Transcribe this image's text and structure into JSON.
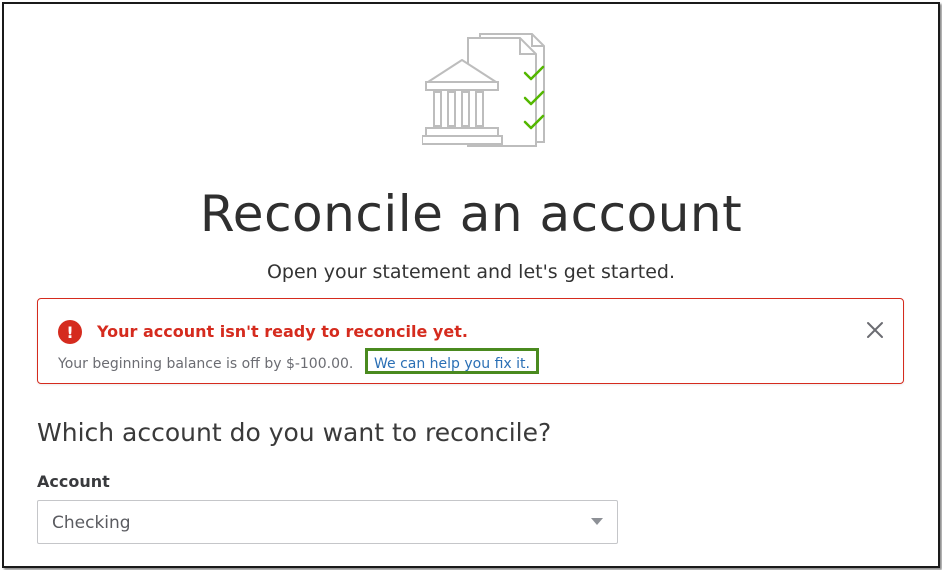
{
  "page": {
    "title": "Reconcile an account",
    "subtitle": "Open your statement and let's get started."
  },
  "illustration": {
    "icon": "bank-document-checklist-icon"
  },
  "alert": {
    "icon": "error-icon",
    "glyph": "!",
    "title": "Your account isn't ready to reconcile yet.",
    "message": "Your beginning balance is off by $-100.00.",
    "link": "We can help you fix it.",
    "close_icon": "close-icon"
  },
  "form": {
    "question": "Which account do you want to reconcile?",
    "account_label": "Account",
    "account_value": "Checking",
    "dropdown_icon": "chevron-down-icon"
  },
  "colors": {
    "error": "#d52b1e",
    "link": "#2a6fb5",
    "highlight": "#4a8a1f",
    "check": "#53b700"
  }
}
